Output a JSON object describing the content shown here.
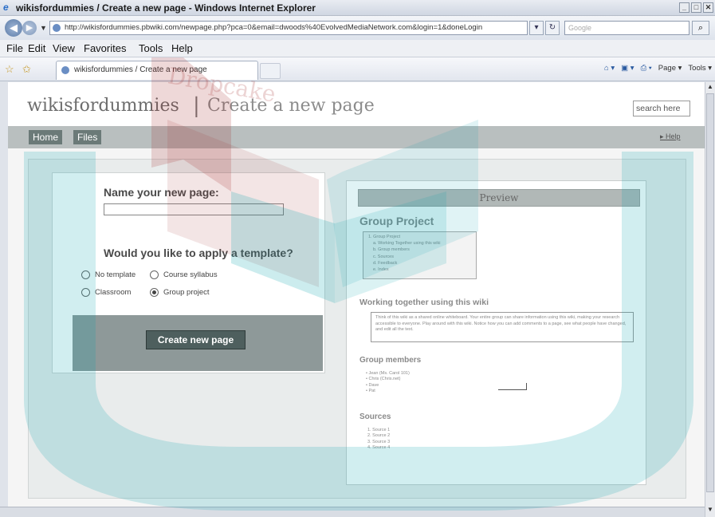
{
  "window": {
    "title": "wikisfordummies / Create a new page - Windows Internet Explorer",
    "min_glyph": "_",
    "max_glyph": "□",
    "close_glyph": "✕"
  },
  "address_bar": {
    "url": "http://wikisfordummies.pbwiki.com/newpage.php?pca=0&email=dwoods%40EvolvedMediaNetwork.com&login=1&doneLogin",
    "search_placeholder": "Google"
  },
  "menu": [
    "File",
    "Edit",
    "View",
    "Favorites",
    "Tools",
    "Help"
  ],
  "tabs": [
    {
      "label": "wikisfordummies / Create a new page"
    }
  ],
  "command_bar": {
    "page_label": "Page ▾",
    "tools_label": "Tools ▾"
  },
  "site": {
    "wiki_name": "wikisfordummies",
    "separator": "|",
    "page_title": "Create a new page",
    "search_value": "search here",
    "nav": [
      "Home",
      "Files"
    ],
    "help_link": "Help"
  },
  "form": {
    "name_label": "Name your new page:",
    "name_value": "",
    "template_label": "Would you like to apply a template?",
    "templates": [
      {
        "label": "No template",
        "selected": false
      },
      {
        "label": "Course syllabus",
        "selected": false
      },
      {
        "label": "Classroom",
        "selected": false
      },
      {
        "label": "Group project",
        "selected": true
      }
    ],
    "create_button": "Create new page"
  },
  "preview": {
    "header": "Preview",
    "title": "Group Project",
    "toc": [
      "1. Group Project",
      "a. Working Together using this wiki",
      "b. Group members",
      "c. Sources",
      "d. Feedback",
      "e. Index"
    ],
    "section1": "Working together using this wiki",
    "section1_text": "Think of this wiki as a shared online whiteboard. Your entire group can share information using this wiki, making your research accessible to everyone. Play around with this wiki. Notice how you can add comments to a page, see what people have changed, and edit all the text.",
    "section2": "Group members",
    "members": [
      "Jean (Ms. Carol 101)",
      "Chris (Chris.net)",
      "Dave",
      "Pat"
    ],
    "section3": "Sources",
    "sources": [
      "1. Source 1",
      "2. Source 2",
      "3. Source 3",
      "4. Source 4"
    ]
  },
  "watermark": {
    "text": "Dropcake"
  }
}
